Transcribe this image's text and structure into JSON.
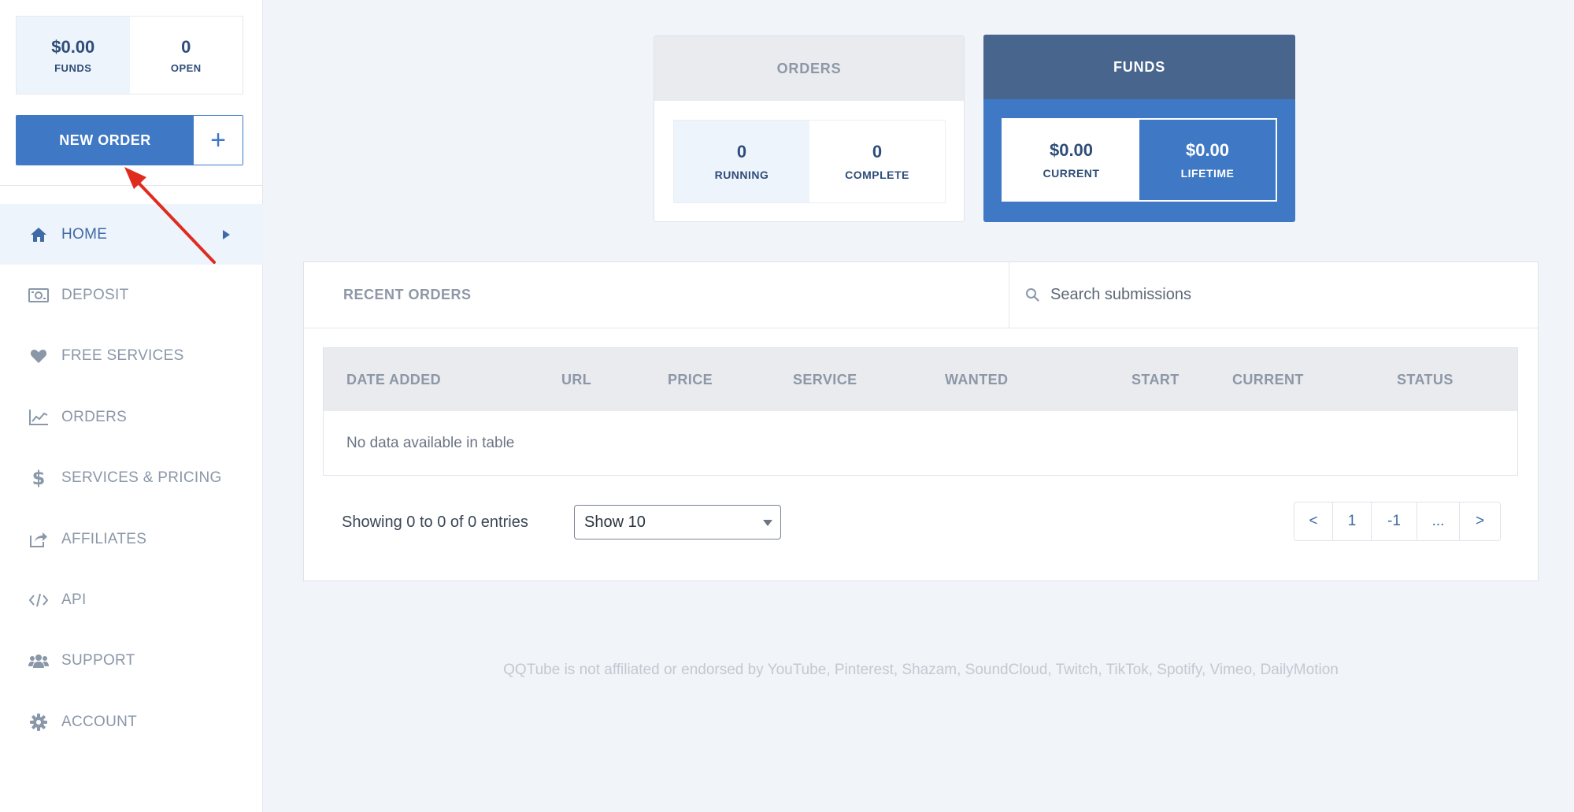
{
  "sidebar": {
    "stats": {
      "funds_value": "$0.00",
      "funds_label": "FUNDS",
      "open_value": "0",
      "open_label": "OPEN"
    },
    "new_order_label": "NEW ORDER",
    "new_order_plus": "+",
    "nav": [
      {
        "label": "HOME",
        "icon": "home-icon",
        "active": true
      },
      {
        "label": "DEPOSIT",
        "icon": "money-bill-icon"
      },
      {
        "label": "FREE SERVICES",
        "icon": "heart-icon"
      },
      {
        "label": "ORDERS",
        "icon": "line-chart-icon"
      },
      {
        "label": "SERVICES & PRICING",
        "icon": "dollar-icon"
      },
      {
        "label": "AFFILIATES",
        "icon": "share-icon"
      },
      {
        "label": "API",
        "icon": "code-icon"
      },
      {
        "label": "SUPPORT",
        "icon": "users-icon"
      },
      {
        "label": "ACCOUNT",
        "icon": "gear-icon"
      }
    ]
  },
  "orders_card": {
    "title": "ORDERS",
    "running_value": "0",
    "running_label": "RUNNING",
    "complete_value": "0",
    "complete_label": "COMPLETE"
  },
  "funds_card": {
    "title": "FUNDS",
    "current_value": "$0.00",
    "current_label": "CURRENT",
    "lifetime_value": "$0.00",
    "lifetime_label": "LIFETIME"
  },
  "recent_orders": {
    "title": "RECENT ORDERS",
    "search_placeholder": "Search submissions",
    "columns": [
      "DATE ADDED",
      "URL",
      "PRICE",
      "SERVICE",
      "WANTED",
      "START",
      "CURRENT",
      "STATUS"
    ],
    "empty_text": "No data available in table",
    "showing_text": "Showing 0 to 0 of 0 entries",
    "page_size": "Show 10",
    "pager": [
      "<",
      "1",
      "-1",
      "...",
      ">"
    ]
  },
  "disclaimer": "QQTube is not affiliated or endorsed by YouTube, Pinterest, Shazam, SoundCloud, Twitch, TikTok, Spotify, Vimeo, DailyMotion",
  "colors": {
    "accent": "#3f78c4",
    "funds_header": "#48658e",
    "annotation_arrow": "#e02b1f"
  }
}
